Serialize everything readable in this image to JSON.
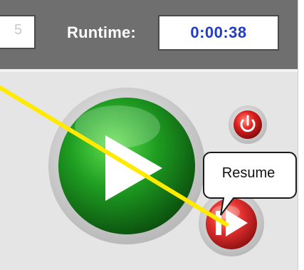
{
  "header": {
    "runtime_label": "Runtime:",
    "runtime_value": "0:00:38",
    "prev_field_text": "5"
  },
  "buttons": {
    "play": {
      "icon": "play-icon",
      "color": "#1e8f1e"
    },
    "power": {
      "icon": "power-icon",
      "color": "#d42020"
    },
    "resume": {
      "icon": "resume-icon",
      "color": "#e02a2a"
    }
  },
  "tooltip": {
    "text": "Resume"
  },
  "annotation": {
    "color": "#ffea00"
  }
}
